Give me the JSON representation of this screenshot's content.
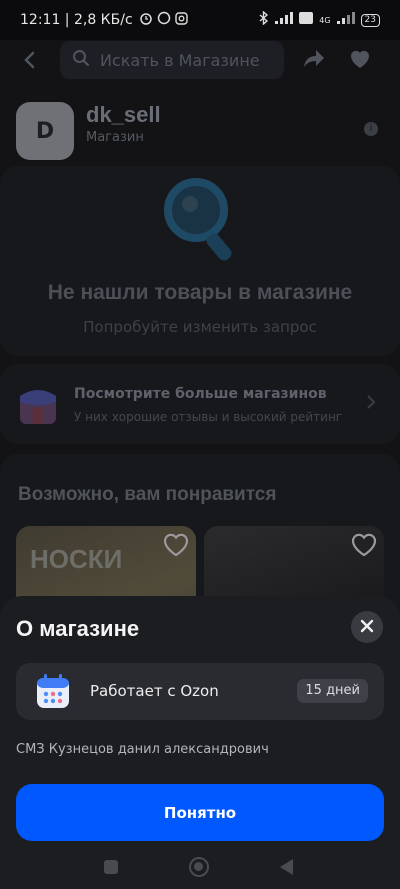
{
  "status_bar": {
    "time_speed": "12:11 | 2,8 КБ/с",
    "network_label": "4G",
    "battery": "23"
  },
  "topbar": {
    "search_placeholder": "Искать в Магазине"
  },
  "shop": {
    "avatar_letter": "D",
    "name": "dk_sell",
    "type": "Магазин"
  },
  "empty_state": {
    "title": "Не нашли товары в магазине",
    "subtitle": "Попробуйте изменить запрос"
  },
  "more_shops": {
    "title": "Посмотрите больше магазинов",
    "subtitle": "У них хорошие отзывы и высокий рейтинг"
  },
  "recommendations": {
    "title": "Возможно, вам понравится",
    "products": [
      {
        "image_text": "НОСКИ"
      },
      {
        "image_text": ""
      }
    ]
  },
  "sheet": {
    "title": "О магазине",
    "ozon_label": "Работает с Ozon",
    "days_badge": "15 дней",
    "legal_name": "СМЗ Кузнецов данил александрович",
    "ok_button": "Понятно"
  },
  "colors": {
    "accent": "#0058ff",
    "sheet_bg": "#1c1d21"
  }
}
